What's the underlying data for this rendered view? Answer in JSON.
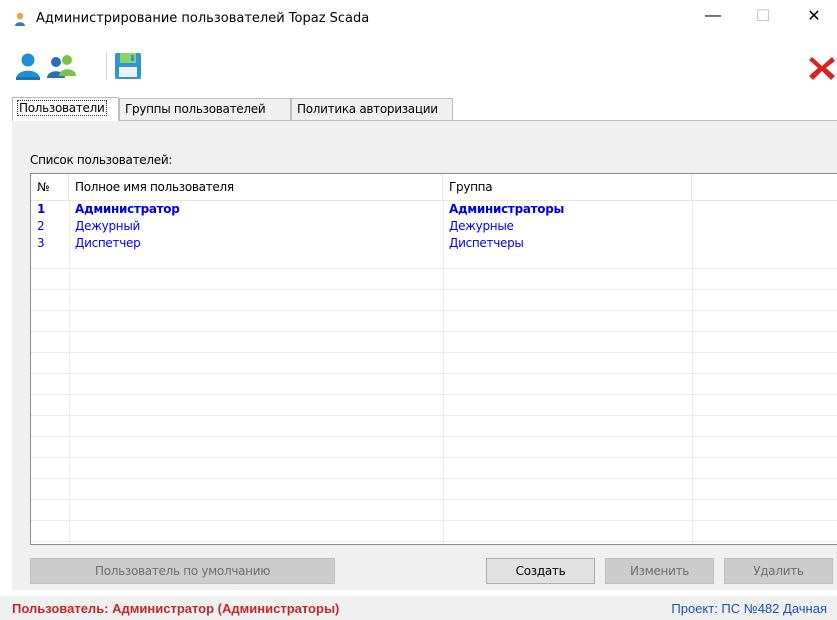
{
  "window": {
    "title": "Администрирование пользователей Topaz Scada",
    "minimize": "—",
    "maximize": "☐",
    "close": "✕"
  },
  "toolbar": {
    "items": [
      {
        "icon": "user-icon"
      },
      {
        "icon": "users-group-icon"
      },
      {
        "icon": "save-icon"
      },
      {
        "icon": "exit-icon"
      }
    ]
  },
  "tabs": [
    {
      "label": "Пользователи",
      "active": true
    },
    {
      "label": "Группы пользователей",
      "active": false
    },
    {
      "label": "Политика авторизации",
      "active": false
    }
  ],
  "users_list": {
    "label": "Список пользователей:",
    "columns": [
      "№",
      "Полное имя пользователя",
      "Группа",
      ""
    ],
    "rows": [
      {
        "num": "1",
        "name": "Администратор",
        "group": "Администраторы",
        "bold": true
      },
      {
        "num": "2",
        "name": "Дежурный",
        "group": "Дежурные",
        "bold": false
      },
      {
        "num": "3",
        "name": "Диспетчер",
        "group": "Диспетчеры",
        "bold": false
      }
    ]
  },
  "buttons": {
    "default_user": "Пользователь по умолчанию",
    "create": "Создать",
    "edit": "Изменить",
    "delete": "Удалить"
  },
  "status": {
    "user": "Пользователь: Администратор (Администраторы)",
    "project": "Проект: ПС №482 Дачная"
  },
  "colors": {
    "status_user": "#c0282d",
    "status_project": "#1a4fb5",
    "row_text": "#0000ff"
  }
}
